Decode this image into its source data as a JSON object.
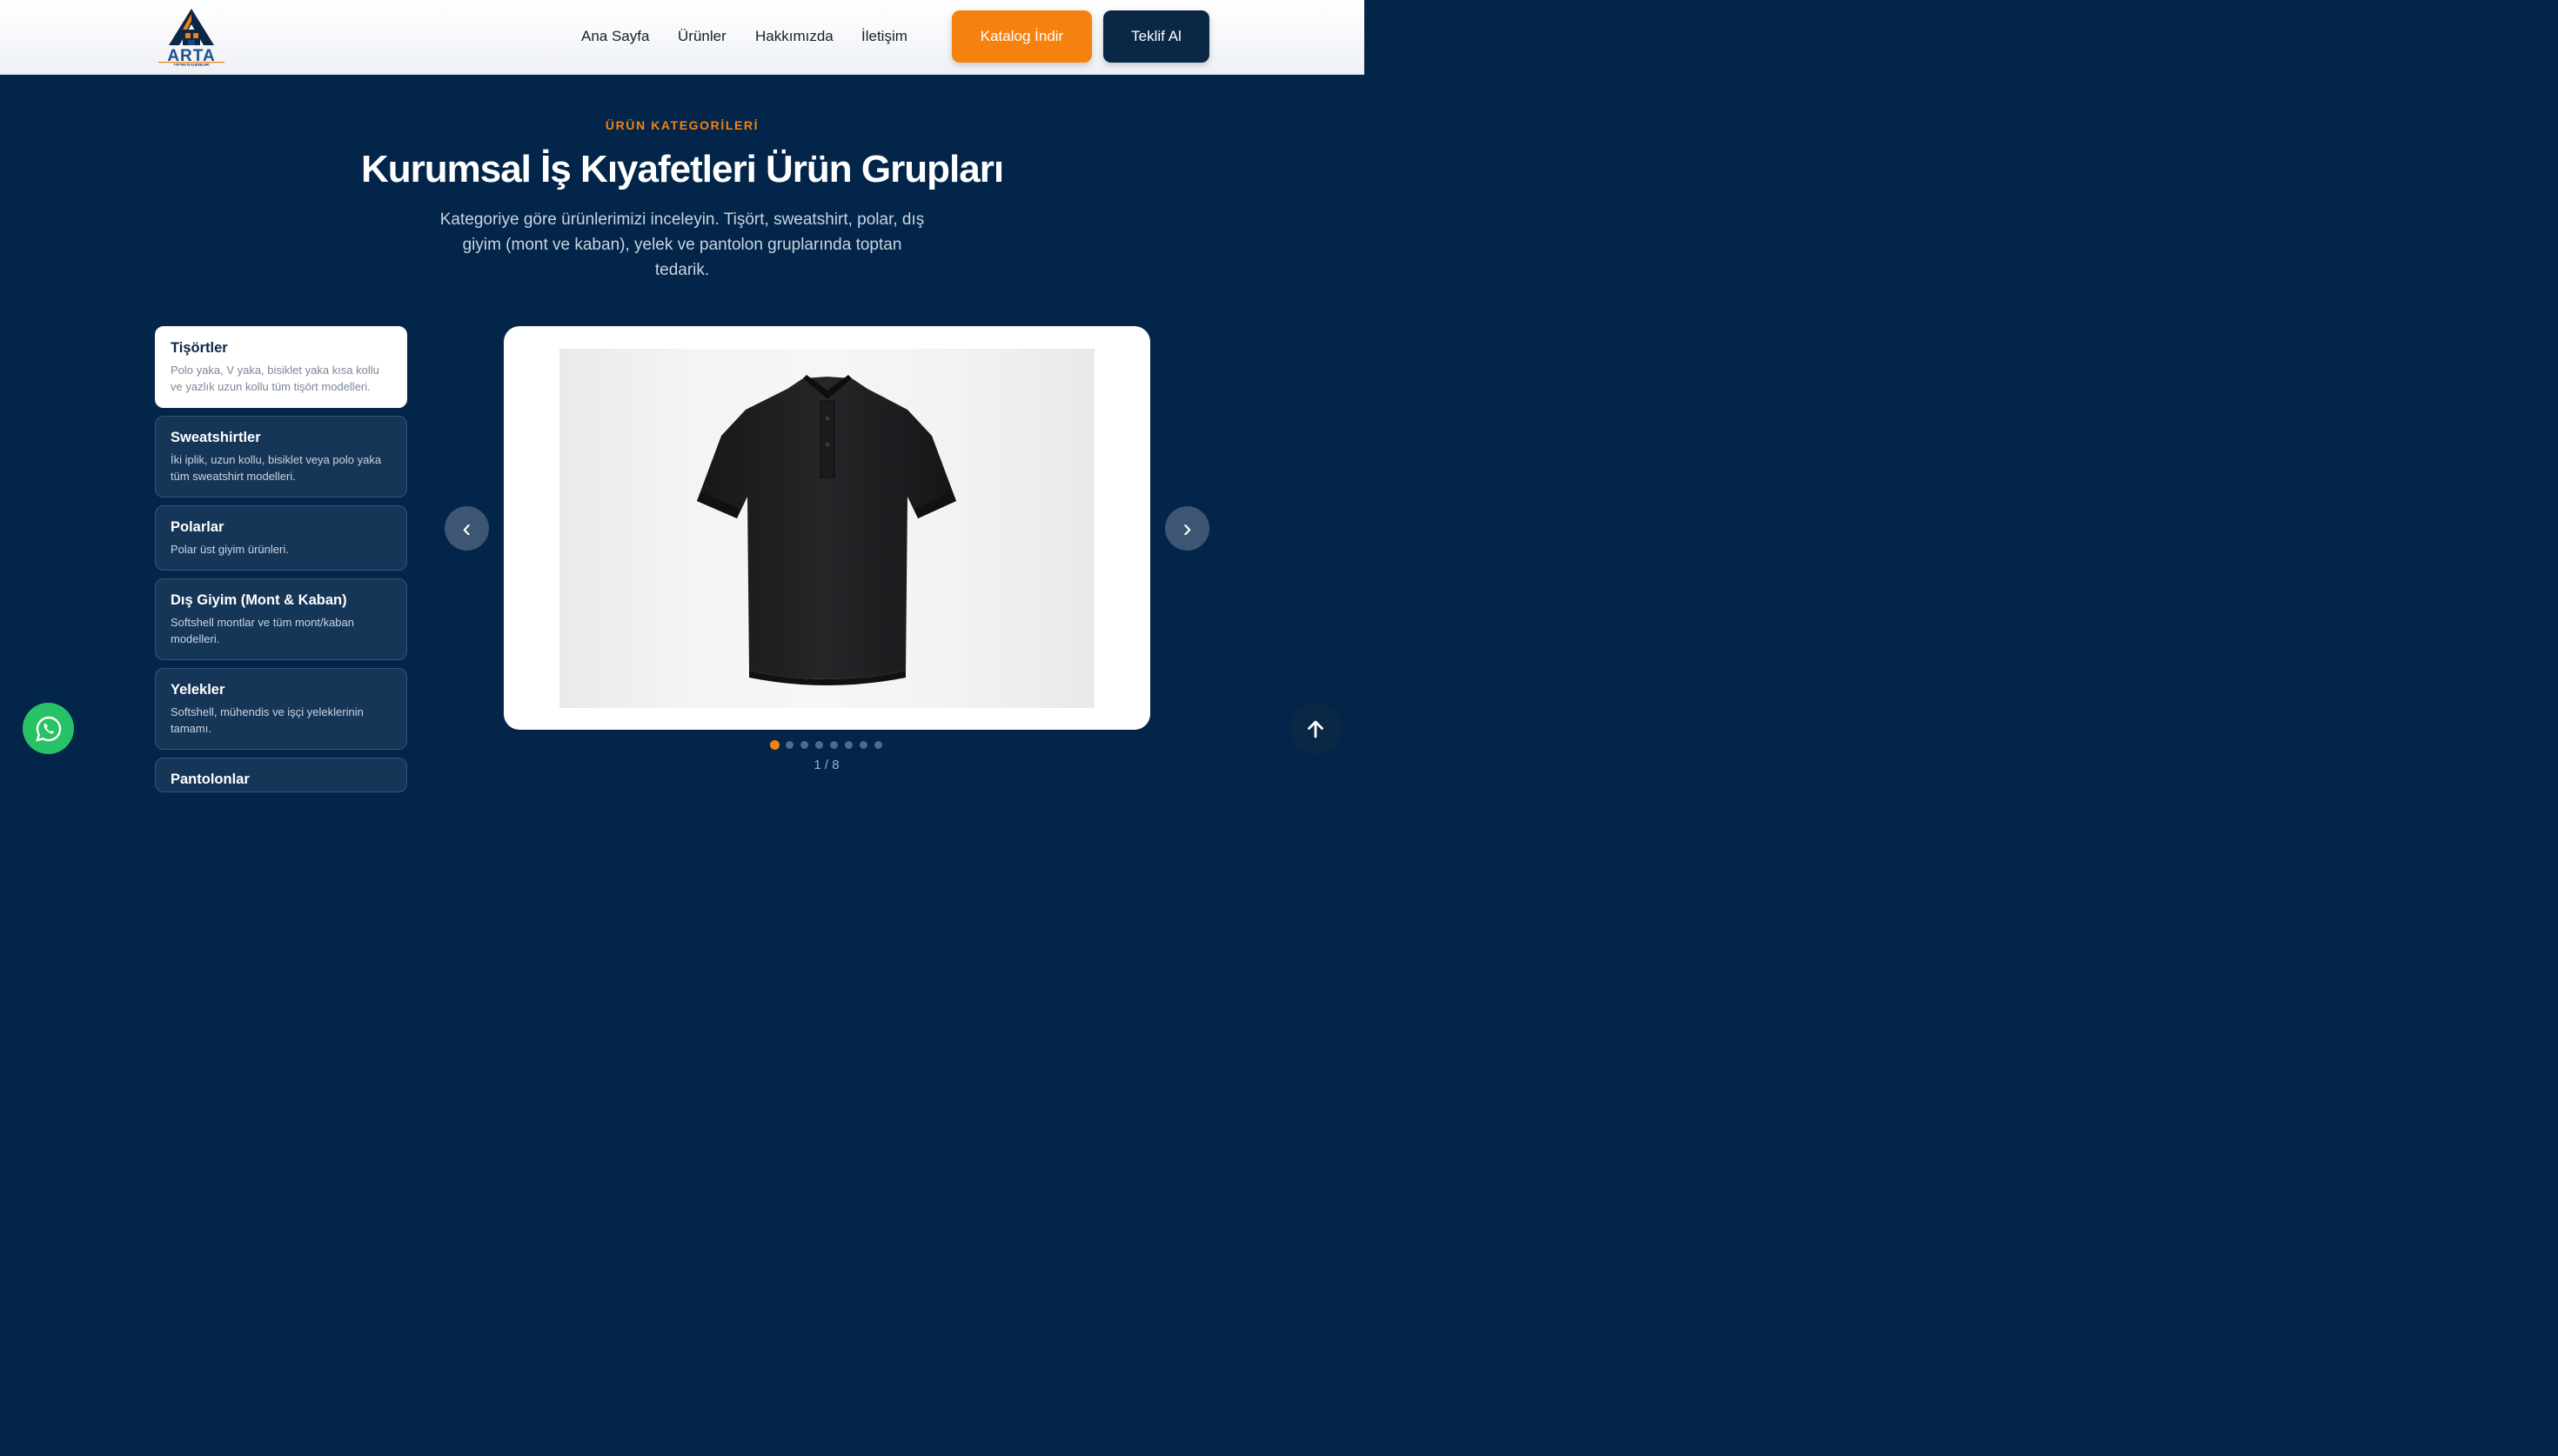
{
  "header": {
    "logo": {
      "brand": "ARTA",
      "tagline": "TOPTAN İŞ ELBİSELERİ"
    },
    "nav": [
      "Ana Sayfa",
      "Ürünler",
      "Hakkımızda",
      "İletişim"
    ],
    "catalog_button": "Katalog İndir",
    "quote_button": "Teklif Al"
  },
  "section": {
    "eyebrow": "ÜRÜN KATEGORİLERİ",
    "title": "Kurumsal İş Kıyafetleri Ürün Grupları",
    "subtitle": "Kategoriye göre ürünlerimizi inceleyin. Tişört, sweatshirt, polar, dış giyim (mont ve kaban), yelek ve pantolon gruplarında toptan tedarik."
  },
  "categories": [
    {
      "name": "Tişörtler",
      "desc": "Polo yaka, V yaka, bisiklet yaka kısa kollu ve yazlık uzun kollu tüm tişört modelleri.",
      "active": true
    },
    {
      "name": "Sweatshirtler",
      "desc": "İki iplik, uzun kollu, bisiklet veya polo yaka tüm sweatshirt modelleri.",
      "active": false
    },
    {
      "name": "Polarlar",
      "desc": "Polar üst giyim ürünleri.",
      "active": false
    },
    {
      "name": "Dış Giyim (Mont & Kaban)",
      "desc": "Softshell montlar ve tüm mont/kaban modelleri.",
      "active": false
    },
    {
      "name": "Yelekler",
      "desc": "Softshell, mühendis ve işçi yeleklerinin tamamı.",
      "active": false
    },
    {
      "name": "Pantolonlar",
      "desc": "",
      "active": false
    }
  ],
  "slider": {
    "image": "black-polo-shirt",
    "prev_icon": "‹",
    "next_icon": "›",
    "total": 8,
    "current": 1,
    "counter": "1 / 8"
  },
  "colors": {
    "accent": "#f5820f",
    "navy": "#03254a",
    "whatsapp": "#27c266"
  },
  "icons": {
    "whatsapp": "whatsapp-icon",
    "scroll_top": "arrow-up-icon"
  }
}
